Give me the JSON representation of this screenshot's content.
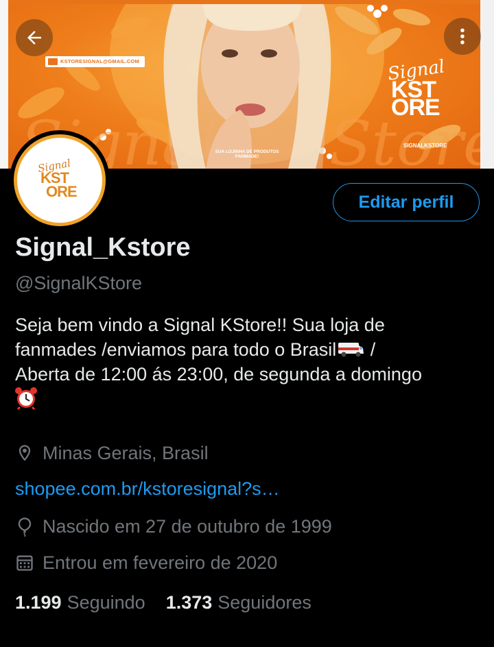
{
  "banner": {
    "email_text": "KSTORESIGNAL@GMAIL.COM",
    "tagline": "SUA LOJINHA DE PRODUTOS FANMADE!",
    "brand_script": "Signal",
    "brand_kst": "KST",
    "brand_ore": "ORE",
    "brand_handle": "SIGNALKSTORE"
  },
  "avatar": {
    "script": "Signal",
    "kst": "KST",
    "ore": "ORE"
  },
  "profile": {
    "edit_button": "Editar perfil",
    "name": "Signal_Kstore",
    "handle": "@SignalKStore",
    "bio_line1": "Seja bem vindo a Signal KStore!! Sua loja de",
    "bio_line2a": "fanmades /enviamos para todo o Brasil",
    "bio_line2b": " /",
    "bio_line3": "Aberta de 12:00 ás 23:00, de segunda a domingo",
    "location": "Minas Gerais, Brasil",
    "website": "shopee.com.br/kstoresignal?s…",
    "birthday": "Nascido em 27 de outubro de 1999",
    "joined": "Entrou em fevereiro de 2020"
  },
  "stats": {
    "following_count": "1.199",
    "following_label": "Seguindo",
    "followers_count": "1.373",
    "followers_label": "Seguidores"
  },
  "colors": {
    "accent": "#1d9bf0",
    "banner_orange": "#ee7d1a",
    "secondary_text": "#71767b"
  },
  "icons": {
    "back": "arrow-left-icon",
    "more": "more-vertical-icon",
    "location": "location-pin-icon",
    "birthday": "balloon-icon",
    "joined": "calendar-icon"
  }
}
